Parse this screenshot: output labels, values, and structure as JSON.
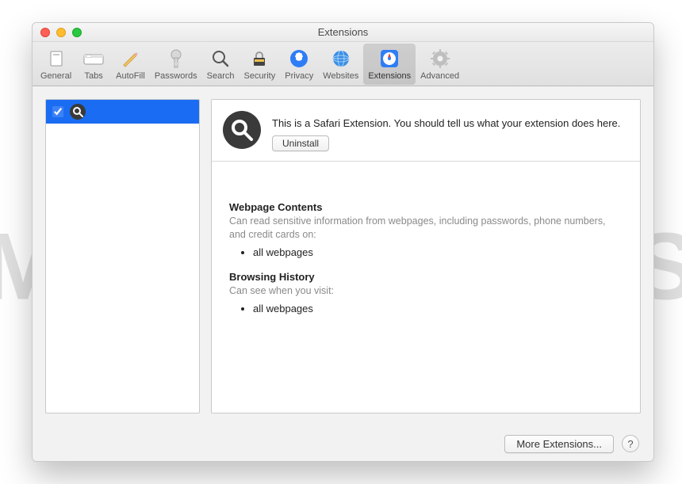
{
  "watermark": "MALWARETIPS",
  "window": {
    "title": "Extensions"
  },
  "toolbar": {
    "items": [
      {
        "label": "General"
      },
      {
        "label": "Tabs"
      },
      {
        "label": "AutoFill"
      },
      {
        "label": "Passwords"
      },
      {
        "label": "Search"
      },
      {
        "label": "Security"
      },
      {
        "label": "Privacy"
      },
      {
        "label": "Websites"
      },
      {
        "label": "Extensions"
      },
      {
        "label": "Advanced"
      }
    ]
  },
  "sidebar": {
    "items": [
      {
        "checked": true,
        "icon": "magnifier"
      }
    ]
  },
  "extension": {
    "description": "This is a Safari Extension. You should tell us what your extension does here.",
    "uninstall_label": "Uninstall"
  },
  "permissions": {
    "webpage": {
      "title": "Webpage Contents",
      "desc": "Can read sensitive information from webpages, including passwords, phone numbers, and credit cards on:",
      "items": [
        "all webpages"
      ]
    },
    "history": {
      "title": "Browsing History",
      "desc": "Can see when you visit:",
      "items": [
        "all webpages"
      ]
    }
  },
  "footer": {
    "more_label": "More Extensions...",
    "help_label": "?"
  }
}
